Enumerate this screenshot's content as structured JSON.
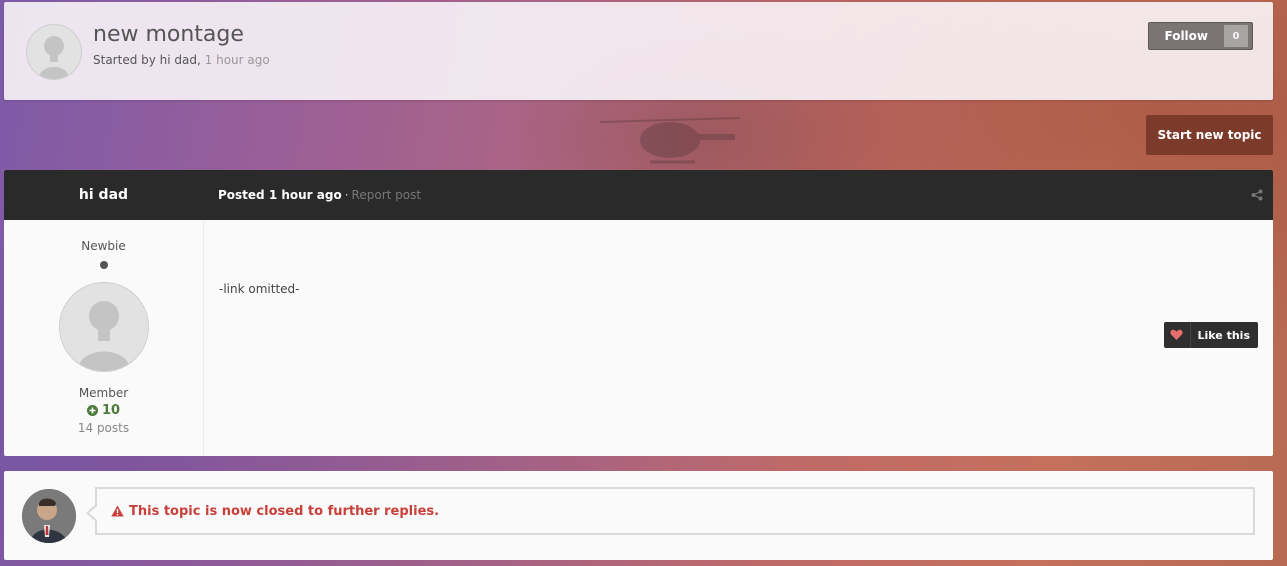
{
  "topic": {
    "title": "new montage",
    "started_by_prefix": "Started by hi dad,",
    "started_ago": "1 hour ago"
  },
  "follow": {
    "label": "Follow",
    "count": "0"
  },
  "start_topic_label": "Start new topic",
  "post": {
    "author": "hi dad",
    "posted_label": "Posted 1 hour ago",
    "separator": "·",
    "report_label": "Report post",
    "rank": "Newbie",
    "group": "Member",
    "reputation": "10",
    "post_count": "14 posts",
    "content": "-link omitted-",
    "like_label": "Like this"
  },
  "closed_notice": "This topic is now closed to further replies.",
  "colors": {
    "post_bar": "#2a2a2a",
    "start_topic_bg": "#7c3b2a",
    "reputation_green": "#4b7a3c",
    "closed_red": "#c9403a",
    "heart": "#e86d6d"
  }
}
